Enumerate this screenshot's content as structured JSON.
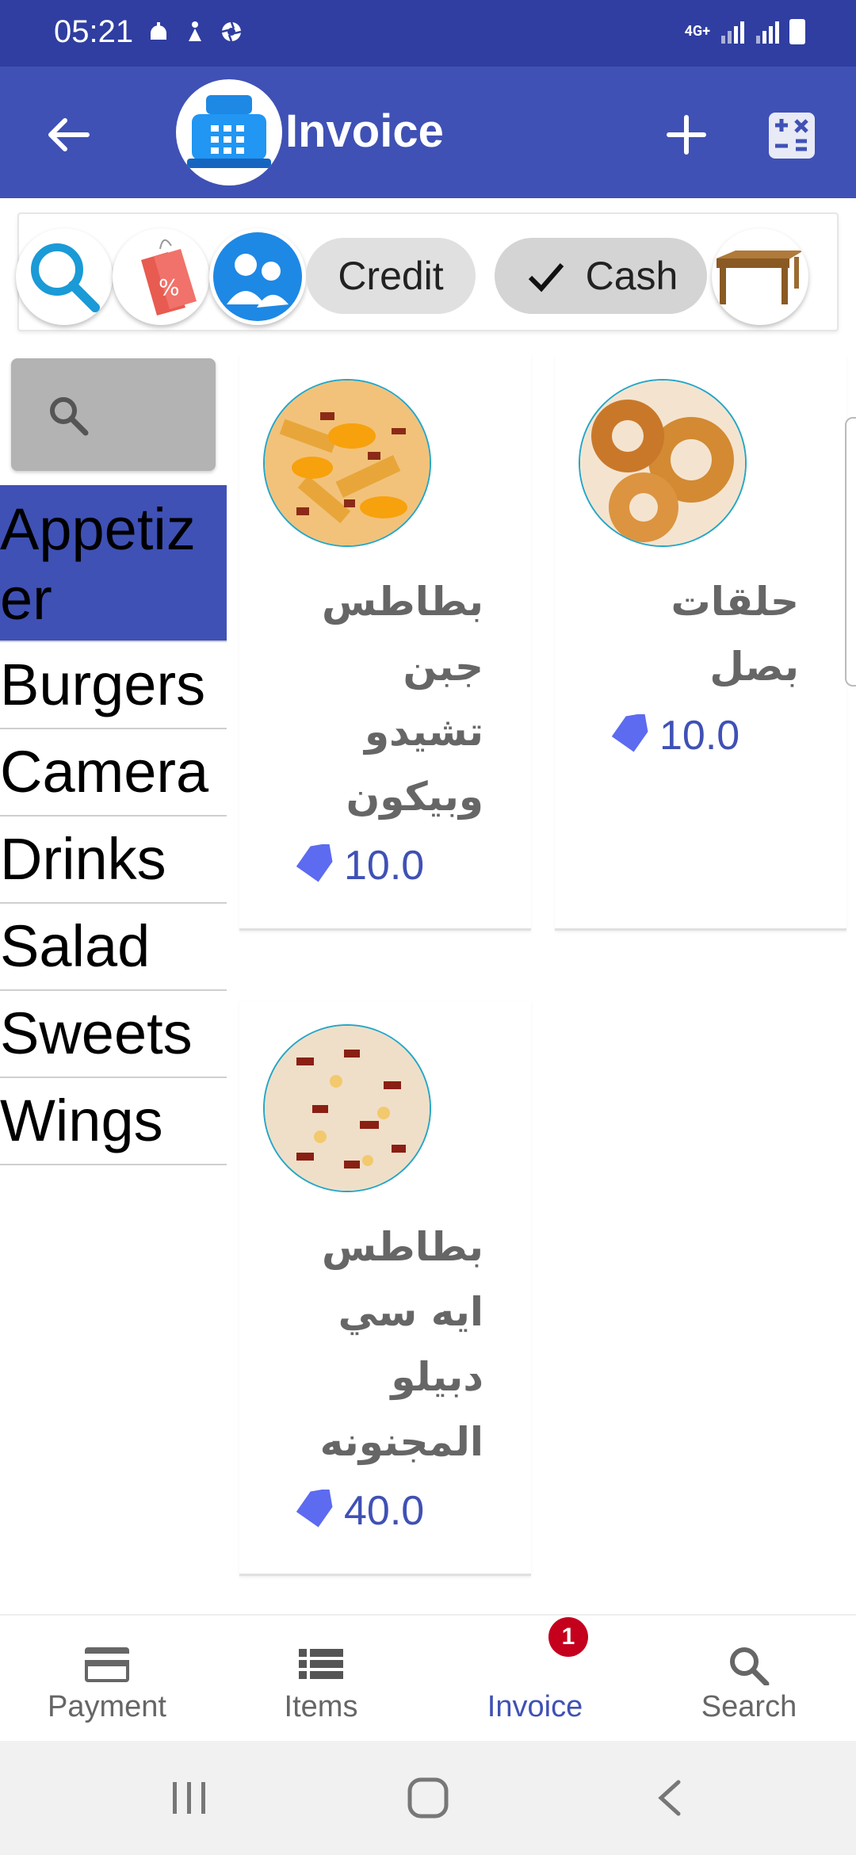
{
  "status_bar": {
    "time": "05:21",
    "network": "4G+"
  },
  "app_bar": {
    "title": "Invoice",
    "brand_color": "#3f51b5",
    "status_color": "#2f3ea0"
  },
  "toolbar": {
    "search_icon": "search-icon",
    "discount_icon": "discount-tag-icon",
    "customer_icon": "customer-icon",
    "credit_label": "Credit",
    "cash_label": "Cash",
    "cash_selected": true,
    "table_icon": "table-icon"
  },
  "categories": [
    {
      "label": "Appetizer",
      "selected": true
    },
    {
      "label": "Burgers",
      "selected": false
    },
    {
      "label": "Camera",
      "selected": false
    },
    {
      "label": "Drinks",
      "selected": false
    },
    {
      "label": "Salad",
      "selected": false
    },
    {
      "label": "Sweets",
      "selected": false
    },
    {
      "label": "Wings",
      "selected": false
    }
  ],
  "products": [
    {
      "name_lines": [
        "بطاطس",
        "جبن",
        "تشيدو",
        "وبيكون"
      ],
      "price": "10.0"
    },
    {
      "name_lines": [
        "حلقات",
        "بصل"
      ],
      "price": "10.0"
    },
    {
      "name_lines": [
        "بطاطس",
        "ايه سي",
        "دبيلو",
        "المجنونه"
      ],
      "price": "40.0"
    }
  ],
  "bottom_nav": {
    "items": [
      {
        "label": "Payment",
        "icon": "credit-card-icon",
        "active": false
      },
      {
        "label": "Items",
        "icon": "list-icon",
        "active": false
      },
      {
        "label": "Invoice",
        "icon": "invoice-icon",
        "active": true
      },
      {
        "label": "Search",
        "icon": "search-icon",
        "active": false
      }
    ],
    "invoice_badge": "1"
  }
}
